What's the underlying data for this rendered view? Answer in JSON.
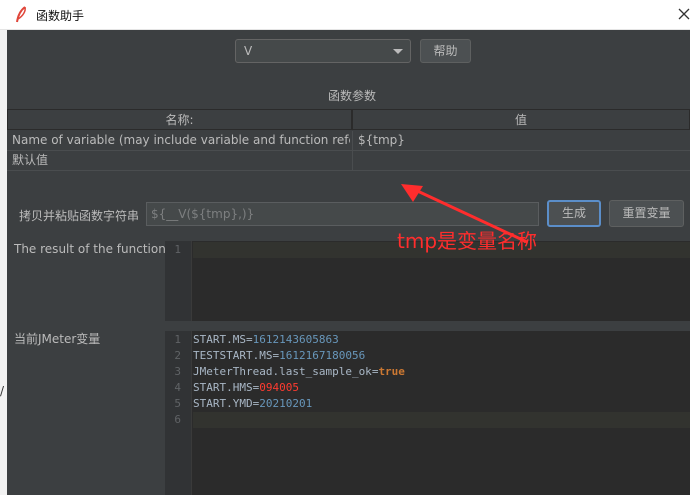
{
  "window": {
    "title": "函数助手",
    "icons": {
      "app": "feather-icon",
      "close": "close-icon"
    }
  },
  "function_select": {
    "value": "V"
  },
  "help_button": {
    "label": "帮助"
  },
  "params": {
    "section_title": "函数参数",
    "headers": {
      "name": "名称:",
      "value": "值"
    },
    "rows": [
      {
        "name": "Name of variable (may include variable and function referenc...",
        "value": "${tmp}"
      },
      {
        "name": "默认值",
        "value": ""
      }
    ]
  },
  "copy": {
    "label": "拷贝并粘贴函数字符串",
    "value": "${__V(${tmp},)}"
  },
  "buttons": {
    "generate": "生成",
    "reset": "重置变量"
  },
  "result": {
    "label": "The result of the function is",
    "lines": [
      ""
    ]
  },
  "jmeter_vars": {
    "label": "当前JMeter变量",
    "lines": [
      {
        "key": "START.MS",
        "value": "1612143605863",
        "type": "number"
      },
      {
        "key": "TESTSTART.MS",
        "value": "1612167180056",
        "type": "number"
      },
      {
        "key": "JMeterThread.last_sample_ok",
        "value": "true",
        "type": "bool"
      },
      {
        "key": "START.HMS",
        "value": "094005",
        "type": "red"
      },
      {
        "key": "START.YMD",
        "value": "20210201",
        "type": "number"
      },
      {
        "key": "",
        "value": "",
        "type": "empty"
      }
    ],
    "line_numbers": [
      "1",
      "2",
      "3",
      "4",
      "5",
      "6"
    ]
  },
  "annotation": {
    "text": "tmp是变量名称",
    "color": "#ff2d2d"
  },
  "outer_mark": "/",
  "colors": {
    "bg": "#3c3f41",
    "editor": "#2b2b2b",
    "number": "#6897bb",
    "keyword": "#cc7832",
    "accent": "#5b8ec9"
  }
}
